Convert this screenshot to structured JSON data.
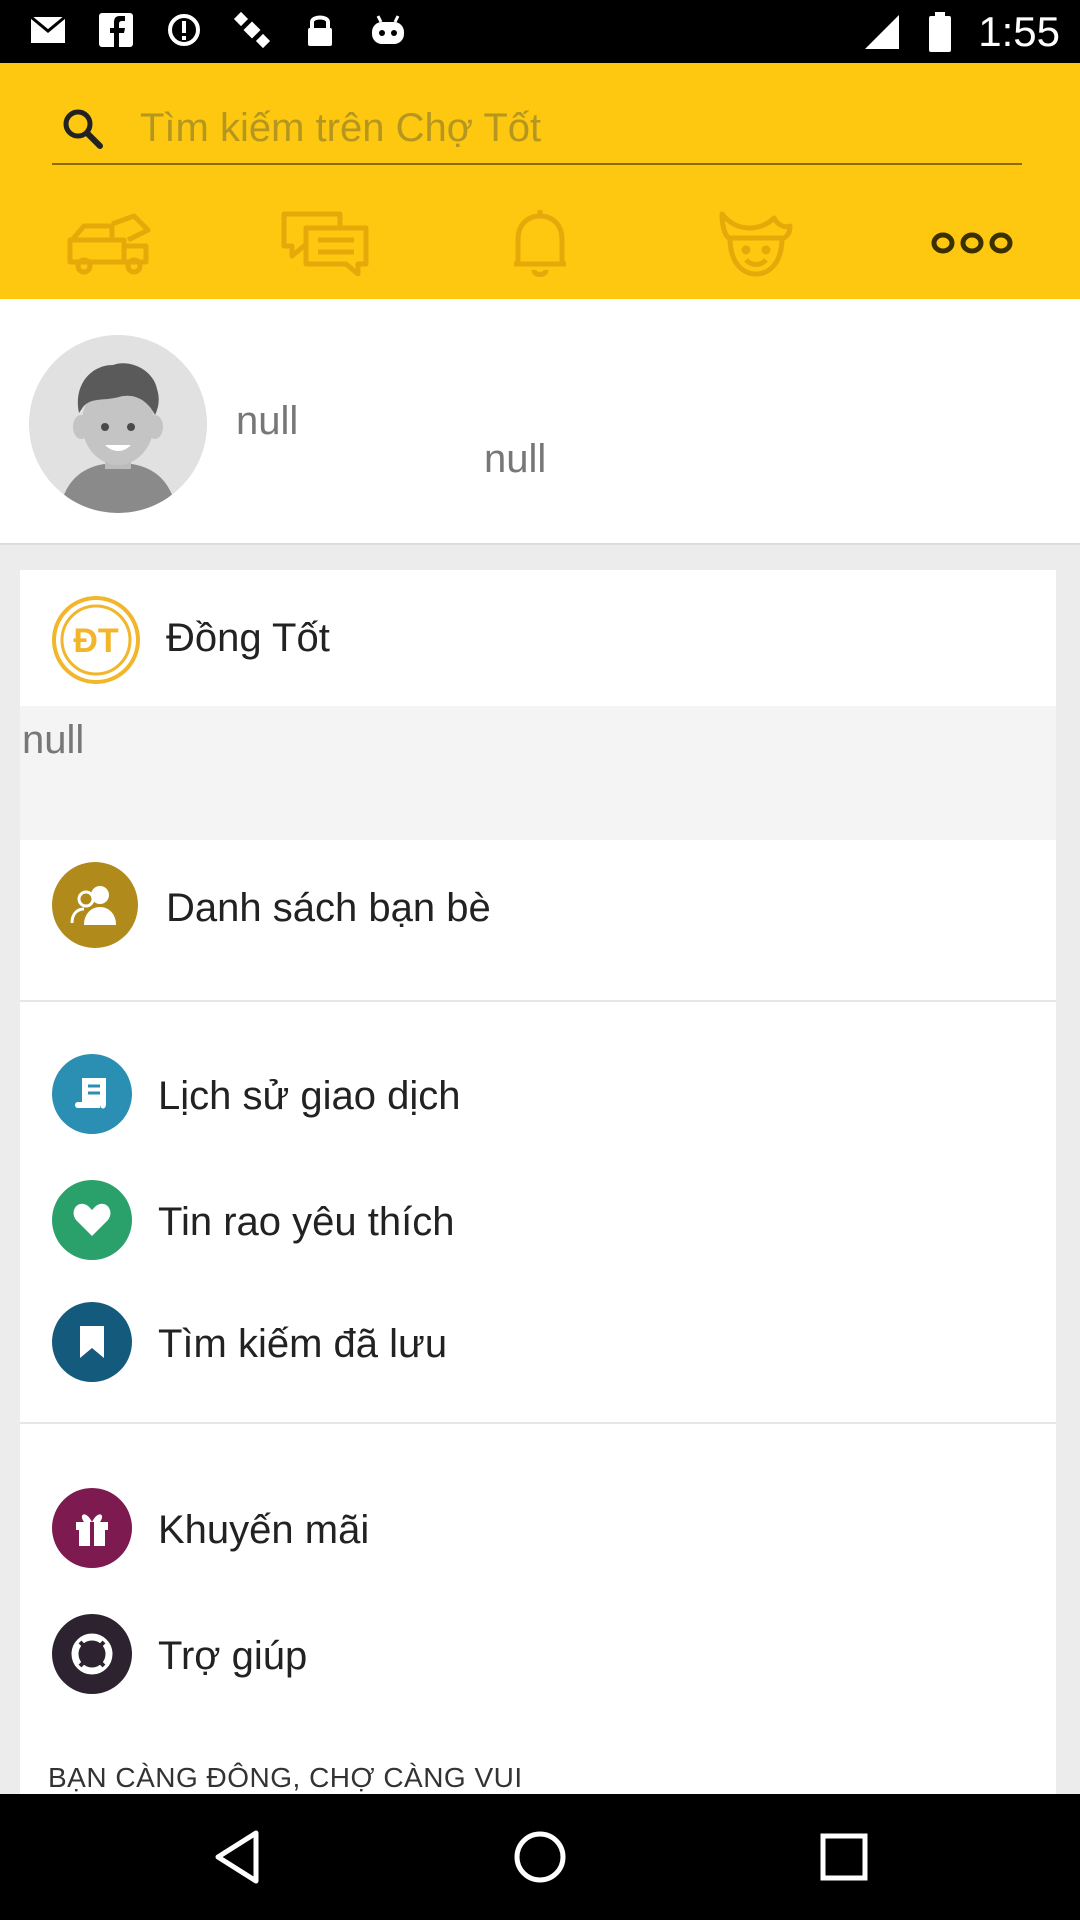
{
  "status_bar": {
    "time": "1:55",
    "left_icons": [
      "mail-icon",
      "facebook-icon",
      "alert-circle-icon",
      "gps-icon",
      "lock-icon",
      "android-icon"
    ],
    "right_icons": [
      "signal-icon",
      "battery-icon"
    ]
  },
  "search": {
    "placeholder": "Tìm kiếm trên Chợ Tốt"
  },
  "nav_icons": [
    "truck-icon",
    "chat-icon",
    "bell-icon",
    "face-icon",
    "more-icon"
  ],
  "profile": {
    "name": "null",
    "subtitle": "null"
  },
  "menu": {
    "dong_tot": {
      "label": "Đồng Tốt",
      "icon_text": "ĐT"
    },
    "dong_tot_value": "null",
    "friends": {
      "label": "Danh sách bạn bè"
    },
    "history": {
      "label": "Lịch sử giao dịch"
    },
    "favorites": {
      "label": "Tin rao yêu thích"
    },
    "saved_search": {
      "label": "Tìm kiếm đã lưu"
    },
    "promotions": {
      "label": "Khuyến mãi"
    },
    "help": {
      "label": "Trợ giúp"
    }
  },
  "footer": {
    "slogan": "BẠN CÀNG ĐÔNG, CHỢ CÀNG VUI"
  },
  "colors": {
    "header_yellow": "#fdc80f",
    "friends_icon": "#b08a1a",
    "history_icon": "#2a8fb3",
    "favorites_icon": "#2aa06b",
    "saved_icon": "#145a7c",
    "promo_icon": "#7d1a4f",
    "help_icon": "#2c2230"
  }
}
